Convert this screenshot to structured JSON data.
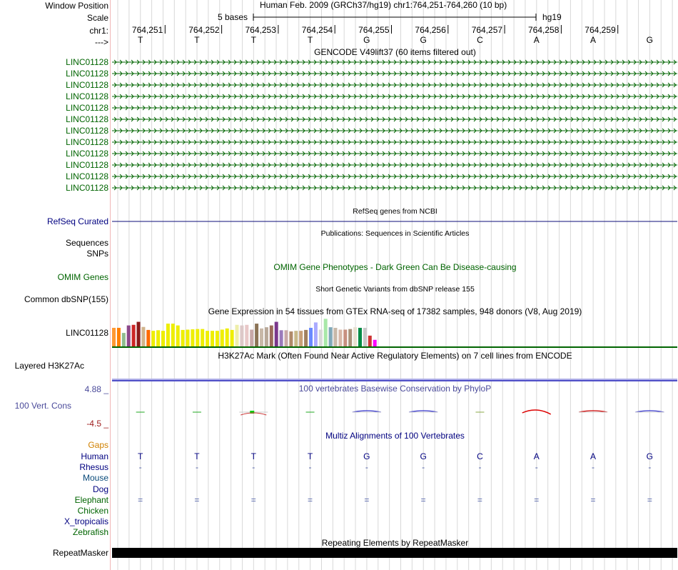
{
  "header": {
    "window_position_label": "Window Position",
    "scale_label": "Scale",
    "chr_label": "chr1:",
    "strand_label": "--->",
    "assembly_title": "Human Feb. 2009 (GRCh37/hg19)   chr1:764,251-764,260 (10 bp)",
    "scale_text": "5 bases",
    "db_label": "hg19",
    "positions": [
      "764,251",
      "764,252",
      "764,253",
      "764,254",
      "764,255",
      "764,256",
      "764,257",
      "764,258",
      "764,259"
    ],
    "bases": [
      "T",
      "T",
      "T",
      "T",
      "G",
      "G",
      "C",
      "A",
      "A",
      "G"
    ]
  },
  "gencode": {
    "title": "GENCODE V49lift37 (60 items filtered out)",
    "genes": [
      "LINC01128",
      "LINC01128",
      "LINC01128",
      "LINC01128",
      "LINC01128",
      "LINC01128",
      "LINC01128",
      "LINC01128",
      "LINC01128",
      "LINC01128",
      "LINC01128",
      "LINC01128"
    ]
  },
  "refseq": {
    "title": "RefSeq genes from NCBI",
    "label": "RefSeq Curated"
  },
  "publications": {
    "title": "Publications: Sequences in Scientific Articles",
    "labels": [
      "Sequences",
      "SNPs"
    ]
  },
  "omim": {
    "title": "OMIM Gene Phenotypes - Dark Green Can Be Disease-causing",
    "label": "OMIM Genes"
  },
  "dbsnp": {
    "title": "Short Genetic Variants from dbSNP release 155",
    "label": "Common dbSNP(155)"
  },
  "gtex": {
    "title": "Gene Expression in 54 tissues from GTEx RNA-seq of 17382 samples, 948 donors (V8, Aug 2019)",
    "label": "LINC01128",
    "bar_colors": [
      "#ff9933",
      "#ff7f00",
      "#8fbc8f",
      "#8b4789",
      "#cd2626",
      "#8b1a1a",
      "#d2b48c",
      "#ff6a00",
      "#eeee00",
      "#eeee00",
      "#eeee00",
      "#eeee00",
      "#eeee00",
      "#eeee00",
      "#eeee00",
      "#eeee00",
      "#eeee00",
      "#eeee00",
      "#eeee00",
      "#eeee00",
      "#eeee00",
      "#eeee00",
      "#eeee00",
      "#eeee00",
      "#eeee00",
      "#eeeeaa",
      "#ddc8c8",
      "#e8c8c8",
      "#c8a8a8",
      "#8b7355",
      "#c8b8a8",
      "#b8a898",
      "#9b6a5a",
      "#7a378b",
      "#9b7abb",
      "#c8a8a8",
      "#b08a6a",
      "#c8b88a",
      "#c8a078",
      "#a08060",
      "#6a8aff",
      "#aaaaff",
      "#d8d8d8",
      "#a8e8a8",
      "#7fa8b8",
      "#c8b8a8",
      "#d8b8a8",
      "#c89080",
      "#a89078",
      "#e8e0d0",
      "#008b45",
      "#c8c8c8",
      "#cd3333",
      "#ff00ff"
    ],
    "bar_values": [
      0.62,
      0.62,
      0.45,
      0.7,
      0.72,
      0.82,
      0.65,
      0.55,
      0.52,
      0.54,
      0.52,
      0.76,
      0.76,
      0.7,
      0.55,
      0.56,
      0.57,
      0.58,
      0.58,
      0.52,
      0.52,
      0.52,
      0.56,
      0.6,
      0.55,
      0.72,
      0.7,
      0.72,
      0.56,
      0.76,
      0.6,
      0.64,
      0.7,
      0.82,
      0.54,
      0.54,
      0.5,
      0.52,
      0.52,
      0.55,
      0.62,
      0.8,
      0.56,
      0.92,
      0.64,
      0.62,
      0.56,
      0.56,
      0.58,
      0.64,
      0.62,
      0.62,
      0.36,
      0.22
    ]
  },
  "h3k27ac": {
    "title": "H3K27Ac Mark (Often Found Near Active Regulatory Elements) on 7 cell lines from ENCODE",
    "label": "Layered H3K27Ac"
  },
  "conservation": {
    "title": "100 vertebrates Basewise Conservation by PhyloP",
    "label": "100 Vert. Cons",
    "max_label": "4.88 _",
    "min_label": "-4.5 _"
  },
  "multiz": {
    "title": "Multiz Alignments of 100 Vertebrates",
    "gaps_label": "Gaps",
    "species": [
      "Human",
      "Rhesus",
      "Mouse",
      "Dog",
      "Elephant",
      "Chicken",
      "X_tropicalis",
      "Zebrafish"
    ],
    "human_bases": [
      "T",
      "T",
      "T",
      "T",
      "G",
      "G",
      "C",
      "A",
      "A",
      "G"
    ],
    "rhesus_marks": [
      "-",
      "-",
      "-",
      "-",
      "-",
      "-",
      "-",
      "-",
      "-",
      "-"
    ],
    "elephant_marks": [
      "=",
      "=",
      "=",
      "=",
      "=",
      "=",
      "=",
      "=",
      "=",
      "="
    ]
  },
  "repeatmasker": {
    "title": "Repeating Elements by RepeatMasker",
    "label": "RepeatMasker"
  },
  "colors": {
    "gencode_green": "#006400",
    "refseq_navy": "#0c0c78",
    "grid": "#d8d8d8",
    "divider": "#f0b8b8"
  }
}
